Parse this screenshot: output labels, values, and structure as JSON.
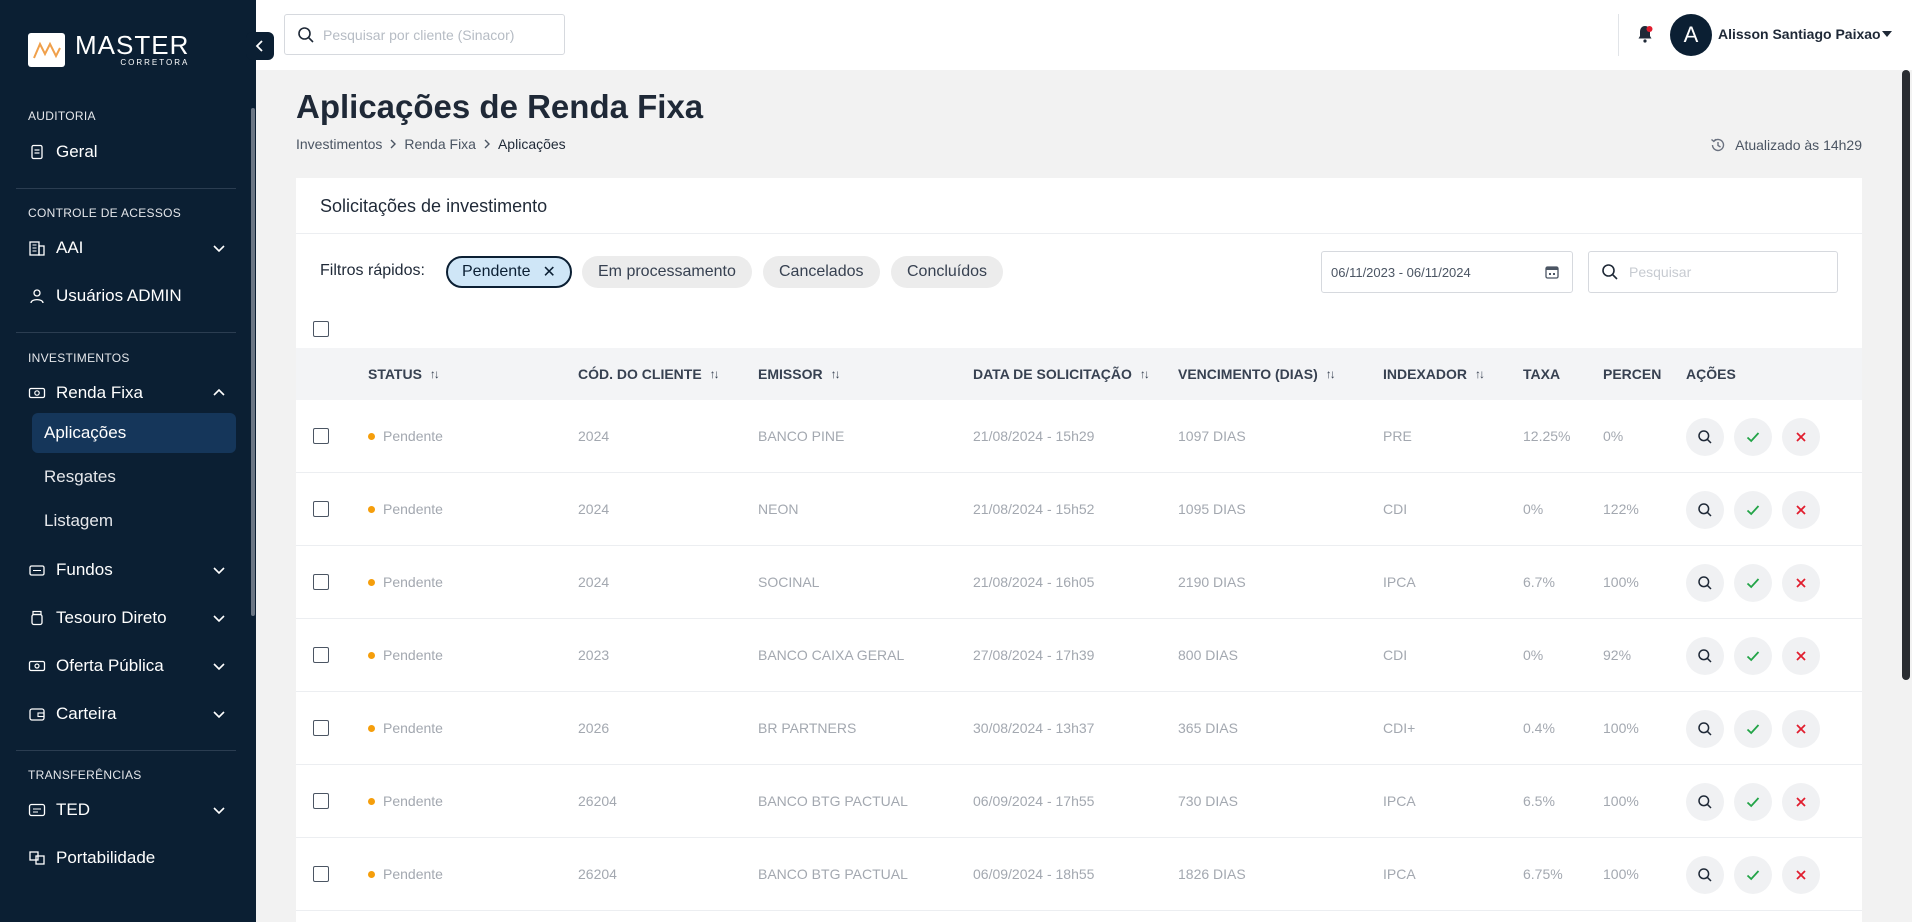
{
  "colors": {
    "sidebar_bg": "#0b1f33",
    "active_item_bg": "#15365a",
    "chip_active_bg": "#cfe6f7",
    "pending_dot": "#f59e0b",
    "approve": "#22a447",
    "reject": "#e11d2e"
  },
  "brand": {
    "name": "MASTER",
    "sub": "CORRETORA"
  },
  "sidebar": {
    "sections": [
      {
        "title": "AUDITORIA"
      },
      {
        "title": "CONTROLE DE ACESSOS"
      },
      {
        "title": "INVESTIMENTOS"
      },
      {
        "title": "TRANSFERÊNCIAS"
      }
    ],
    "items": {
      "geral": "Geral",
      "aai": "AAI",
      "usuarios_admin": "Usuários ADMIN",
      "renda_fixa": "Renda Fixa",
      "aplicacoes": "Aplicações",
      "resgates": "Resgates",
      "listagem": "Listagem",
      "fundos": "Fundos",
      "tesouro_direto": "Tesouro Direto",
      "oferta_publica": "Oferta Pública",
      "carteira": "Carteira",
      "ted": "TED",
      "portabilidade": "Portabilidade"
    }
  },
  "topbar": {
    "search_placeholder": "Pesquisar por cliente (Sinacor)",
    "avatar_initial": "A",
    "user_name": "Alisson Santiago Paixao"
  },
  "header": {
    "title": "Aplicações de Renda Fixa",
    "breadcrumb": [
      "Investimentos",
      "Renda Fixa",
      "Aplicações"
    ],
    "updated": "Atualizado às 14h29"
  },
  "card": {
    "title": "Solicitações de investimento",
    "filters_label": "Filtros rápidos:",
    "chips": [
      "Pendente",
      "Em processamento",
      "Cancelados",
      "Concluídos"
    ],
    "active_chip": "Pendente",
    "date_range": "06/11/2023 - 06/11/2024",
    "search_placeholder": "Pesquisar"
  },
  "table": {
    "columns": [
      "STATUS",
      "CÓD. DO CLIENTE",
      "EMISSOR",
      "DATA DE SOLICITAÇÃO",
      "VENCIMENTO (DIAS)",
      "INDEXADOR",
      "TAXA",
      "PERCENT",
      "AÇÕES"
    ],
    "rows": [
      {
        "status": "Pendente",
        "client": "2024",
        "issuer": "BANCO PINE",
        "date": "21/08/2024 - 15h29",
        "maturity": "1097 DIAS",
        "index": "PRE",
        "rate": "12.25%",
        "percent": "0%"
      },
      {
        "status": "Pendente",
        "client": "2024",
        "issuer": "NEON",
        "date": "21/08/2024 - 15h52",
        "maturity": "1095 DIAS",
        "index": "CDI",
        "rate": "0%",
        "percent": "122%"
      },
      {
        "status": "Pendente",
        "client": "2024",
        "issuer": "SOCINAL",
        "date": "21/08/2024 - 16h05",
        "maturity": "2190 DIAS",
        "index": "IPCA",
        "rate": "6.7%",
        "percent": "100%"
      },
      {
        "status": "Pendente",
        "client": "2023",
        "issuer": "BANCO CAIXA GERAL",
        "date": "27/08/2024 - 17h39",
        "maturity": "800 DIAS",
        "index": "CDI",
        "rate": "0%",
        "percent": "92%"
      },
      {
        "status": "Pendente",
        "client": "2026",
        "issuer": "BR PARTNERS",
        "date": "30/08/2024 - 13h37",
        "maturity": "365 DIAS",
        "index": "CDI+",
        "rate": "0.4%",
        "percent": "100%"
      },
      {
        "status": "Pendente",
        "client": "26204",
        "issuer": "BANCO BTG PACTUAL",
        "date": "06/09/2024 - 17h55",
        "maturity": "730 DIAS",
        "index": "IPCA",
        "rate": "6.5%",
        "percent": "100%"
      },
      {
        "status": "Pendente",
        "client": "26204",
        "issuer": "BANCO BTG PACTUAL",
        "date": "06/09/2024 - 18h55",
        "maturity": "1826 DIAS",
        "index": "IPCA",
        "rate": "6.75%",
        "percent": "100%"
      }
    ]
  }
}
